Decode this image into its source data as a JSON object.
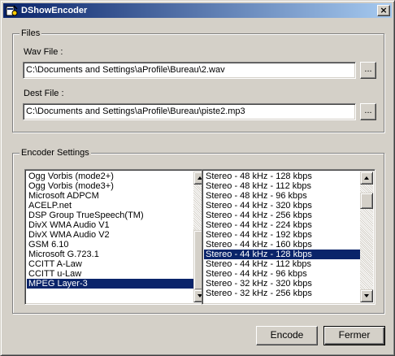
{
  "window": {
    "title": "DShowEncoder",
    "close_glyph": "×"
  },
  "files": {
    "group_title": "Files",
    "wav_label": "Wav File :",
    "wav_value": "C:\\Documents and Settings\\aProfile\\Bureau\\2.wav",
    "dest_label": "Dest File :",
    "dest_value": "C:\\Documents and Settings\\aProfile\\Bureau\\piste2.mp3",
    "browse_label": "..."
  },
  "encoder": {
    "group_title": "Encoder Settings",
    "codecs": [
      "Ogg Vorbis (mode2+)",
      "Ogg Vorbis (mode3+)",
      "Microsoft ADPCM",
      "ACELP.net",
      "DSP Group TrueSpeech(TM)",
      "DivX WMA Audio V1",
      "DivX WMA Audio V2",
      "GSM 6.10",
      "Microsoft G.723.1",
      "CCITT A-Law",
      "CCITT u-Law",
      "MPEG Layer-3"
    ],
    "codec_selected": "MPEG Layer-3",
    "formats": [
      "Stereo - 48 kHz - 128 kbps",
      "Stereo - 48 kHz - 112 kbps",
      "Stereo - 48 kHz - 96 kbps",
      "Stereo - 44 kHz - 320 kbps",
      "Stereo - 44 kHz - 256 kbps",
      "Stereo - 44 kHz - 224 kbps",
      "Stereo - 44 kHz - 192 kbps",
      "Stereo - 44 kHz - 160 kbps",
      "Stereo - 44 kHz - 128 kbps",
      "Stereo - 44 kHz - 112 kbps",
      "Stereo - 44 kHz - 96 kbps",
      "Stereo - 32 kHz - 320 kbps",
      "Stereo - 32 kHz - 256 kbps"
    ],
    "format_selected": "Stereo - 44 kHz - 128 kbps"
  },
  "actions": {
    "encode_label": "Encode",
    "close_label": "Fermer"
  },
  "colors": {
    "face": "#d4d0c8",
    "selection": "#0a246a",
    "title_gradient_start": "#0a246a",
    "title_gradient_end": "#a6caf0"
  }
}
